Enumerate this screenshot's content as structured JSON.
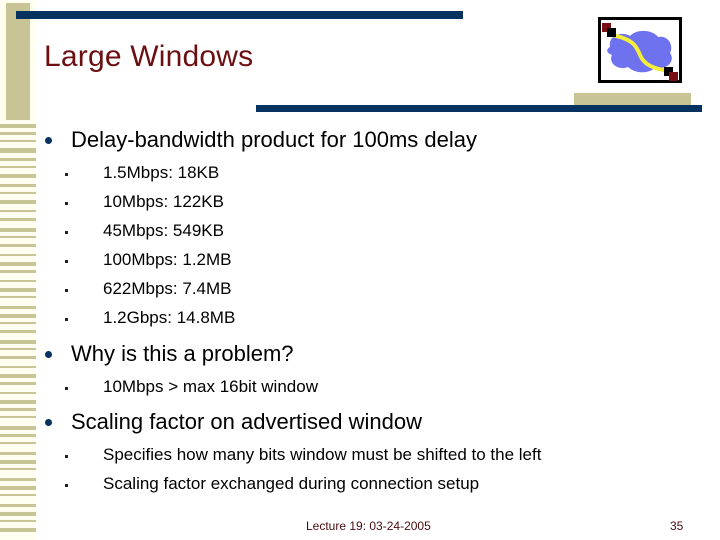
{
  "slide": {
    "title": "Large Windows",
    "bullets": [
      {
        "text": "Delay-bandwidth product for 100ms delay",
        "children": [
          "1.5Mbps: 18KB",
          "10Mbps: 122KB",
          "45Mbps: 549KB",
          "100Mbps: 1.2MB",
          "622Mbps: 7.4MB",
          "1.2Gbps: 14.8MB"
        ]
      },
      {
        "text": "Why is this a problem?",
        "children": [
          "10Mbps > max 16bit window"
        ]
      },
      {
        "text": "Scaling factor on advertised window",
        "children": [
          "Specifies how many bits window must be shifted to the left",
          "Scaling factor exchanged during connection setup"
        ]
      }
    ],
    "footer": {
      "lecture": "Lecture 19: 03-24-2005",
      "page_number": "35"
    },
    "colors": {
      "title": "#6b0f12",
      "rule": "#06325f",
      "rail": "#c8c496"
    },
    "logo_icon": "network-cloud-icon"
  }
}
